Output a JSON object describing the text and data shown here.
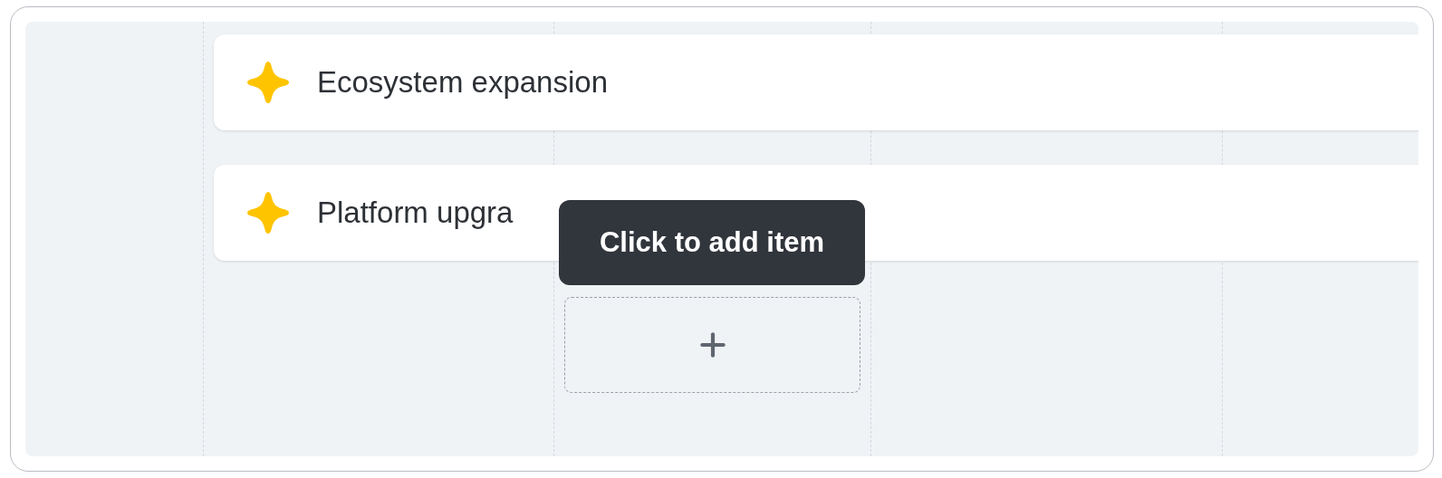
{
  "items": [
    {
      "label": "Ecosystem expansion"
    },
    {
      "label": "Platform upgra"
    }
  ],
  "tooltip": {
    "text": "Click to add item"
  }
}
